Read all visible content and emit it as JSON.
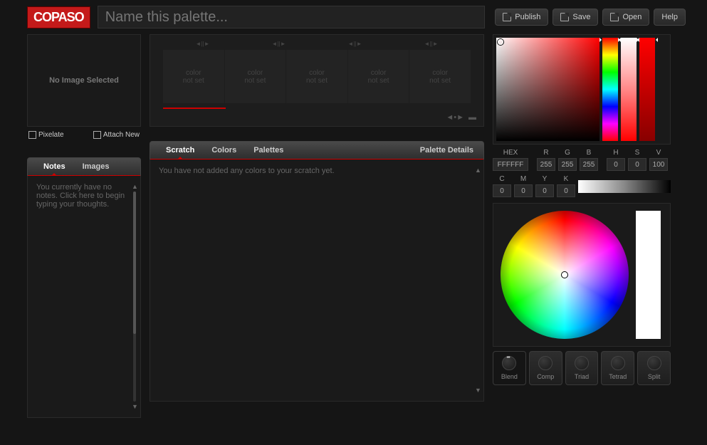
{
  "logo": "COPASO",
  "palette_name_placeholder": "Name this palette...",
  "buttons": {
    "publish": "Publish",
    "save": "Save",
    "open": "Open",
    "help": "Help"
  },
  "image_panel": {
    "placeholder": "No Image Selected",
    "pixelate": "Pixelate",
    "attach": "Attach New"
  },
  "swatches": {
    "placeholder_line1": "color",
    "placeholder_line2": "not set"
  },
  "left_tabs": {
    "notes": "Notes",
    "images": "Images",
    "notes_placeholder": "You currently have no notes. Click here to begin typing your thoughts."
  },
  "middle_tabs": {
    "scratch": "Scratch",
    "colors": "Colors",
    "palettes": "Palettes",
    "details": "Palette Details",
    "scratch_placeholder": "You have not added any colors to your scratch yet."
  },
  "color": {
    "labels": {
      "hex": "HEX",
      "r": "R",
      "g": "G",
      "b": "B",
      "h": "H",
      "s": "S",
      "v": "V",
      "c": "C",
      "m": "M",
      "y": "Y",
      "k": "K"
    },
    "hex": "FFFFFF",
    "r": "255",
    "g": "255",
    "b": "255",
    "hue": "0",
    "sat": "0",
    "val": "100",
    "c": "0",
    "m": "0",
    "y": "0",
    "k": "0"
  },
  "harmony": {
    "blend": "Blend",
    "comp": "Comp",
    "triad": "Triad",
    "tetrad": "Tetrad",
    "split": "Split"
  }
}
